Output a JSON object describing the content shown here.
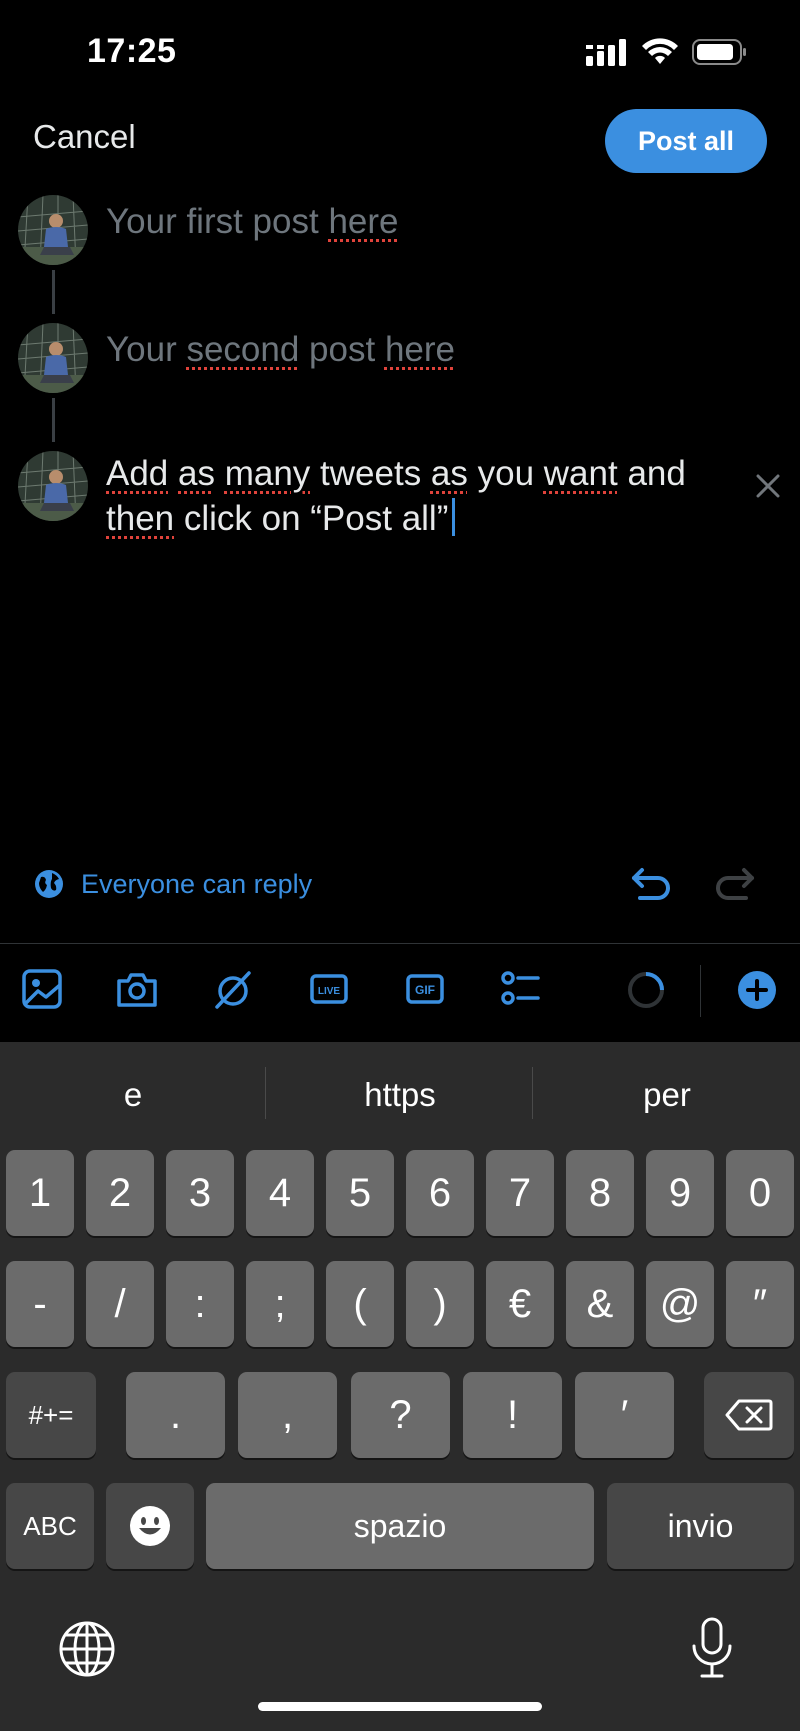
{
  "status_bar": {
    "time": "17:25"
  },
  "header": {
    "cancel_label": "Cancel",
    "post_all_label": "Post all"
  },
  "thread": {
    "posts": [
      {
        "placeholder_parts": [
          "Your first post ",
          "here"
        ]
      },
      {
        "placeholder_parts": [
          "Your ",
          "second",
          " post ",
          "here"
        ]
      },
      {
        "text_parts": [
          "Add",
          " ",
          "as",
          " ",
          "many",
          " tweets ",
          "as",
          " you ",
          "want",
          " and ",
          "then",
          " click on “Post all”"
        ]
      }
    ]
  },
  "reply_settings": {
    "label": "Everyone can reply"
  },
  "toolbar": {
    "icons": [
      "image-icon",
      "camera-icon",
      "grok-icon",
      "live-icon",
      "gif-icon",
      "poll-icon",
      "character-counter-icon",
      "add-post-icon"
    ],
    "live_label": "LIVE",
    "gif_label": "GIF"
  },
  "keyboard": {
    "suggestions": [
      "e",
      "https",
      "per"
    ],
    "row1": [
      "1",
      "2",
      "3",
      "4",
      "5",
      "6",
      "7",
      "8",
      "9",
      "0"
    ],
    "row2": [
      "-",
      "/",
      ":",
      ";",
      "(",
      ")",
      "€",
      "&",
      "@",
      "″"
    ],
    "row3": [
      "#+=",
      ".",
      ",",
      "?",
      "!",
      "′"
    ],
    "abc": "ABC",
    "space": "spazio",
    "return": "invio"
  },
  "colors": {
    "accent": "#3b8fe0",
    "spellcheck": "#e0433b"
  }
}
